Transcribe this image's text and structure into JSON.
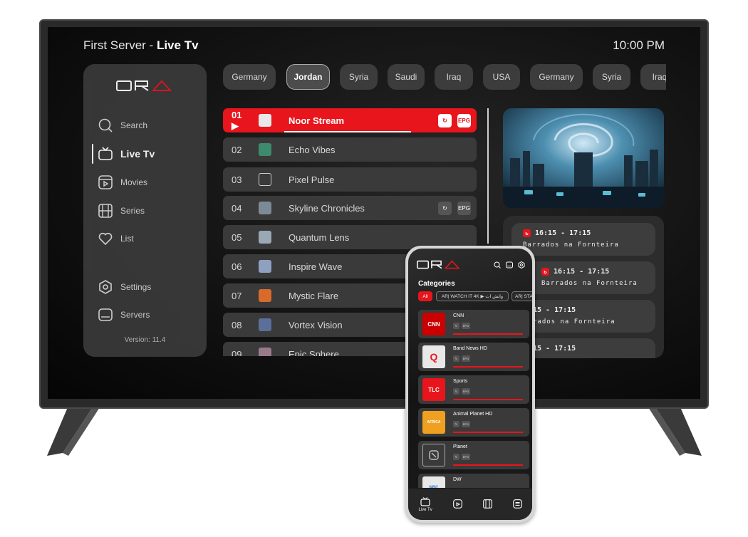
{
  "tv": {
    "server_name": "First Server - ",
    "section": "Live Tv",
    "clock": "10:00 PM",
    "brand": "ORA",
    "sidebar": {
      "items": [
        {
          "label": "Search",
          "icon": "search-icon"
        },
        {
          "label": "Live Tv",
          "icon": "tv-icon",
          "active": true
        },
        {
          "label": "Movies",
          "icon": "movie-icon"
        },
        {
          "label": "Series",
          "icon": "film-icon"
        },
        {
          "label": "List",
          "icon": "heart-icon"
        },
        {
          "label": "Settings",
          "icon": "settings-icon"
        },
        {
          "label": "Servers",
          "icon": "server-icon"
        }
      ],
      "version": "Version: 11.4"
    },
    "tabs": [
      "Germany",
      "Jordan",
      "Syria",
      "Saudi",
      "Iraq",
      "USA",
      "Germany",
      "Syria",
      "Iraq"
    ],
    "active_tab": "Jordan",
    "channels": [
      {
        "num": "01",
        "name": "Noor Stream",
        "active": true,
        "badges": true
      },
      {
        "num": "02",
        "name": "Echo Vibes"
      },
      {
        "num": "03",
        "name": "Pixel Pulse"
      },
      {
        "num": "04",
        "name": "Skyline Chronicles",
        "badges": true
      },
      {
        "num": "05",
        "name": "Quantum Lens"
      },
      {
        "num": "06",
        "name": "Inspire Wave"
      },
      {
        "num": "07",
        "name": "Mystic Flare"
      },
      {
        "num": "08",
        "name": "Vortex Vision"
      },
      {
        "num": "09",
        "name": "Epic Sphere"
      }
    ],
    "badge_epg": "EPG",
    "epg": [
      {
        "time": "16:15 - 17:15",
        "program": "Barrados na Fornteira"
      },
      {
        "time": "16:15 - 17:15",
        "program": "Barrados na Fornteira"
      },
      {
        "time": "15 - 17:15",
        "program": "rados na Fornteira"
      },
      {
        "time": "15 - 17:15",
        "program": ""
      }
    ]
  },
  "phone": {
    "brand": "ORA",
    "categories_title": "Categories",
    "chips": [
      "All",
      "AR| WATCH IT 4K ▶ واتش ات",
      "AR| STA"
    ],
    "channels": [
      {
        "name": "CNN",
        "thumb": "CNN",
        "thumb_color": "#cc0000"
      },
      {
        "name": "Band News HD",
        "thumb": "Q",
        "thumb_color": "#e8151d"
      },
      {
        "name": "Sports",
        "thumb": "TLC",
        "thumb_color": "#e8151d"
      },
      {
        "name": "Animal Planet HD",
        "thumb": "AFRICA",
        "thumb_color": "#f0a020"
      },
      {
        "name": "Planet",
        "thumb": "",
        "thumb_color": "#3a3a3a"
      },
      {
        "name": "DW",
        "thumb": "NBC",
        "thumb_color": "#ffffff"
      }
    ],
    "badge_epg": "EPG",
    "nav": [
      {
        "label": "Live Tv",
        "icon": "tv-icon"
      },
      {
        "label": "",
        "icon": "movie-icon"
      },
      {
        "label": "",
        "icon": "film-icon"
      },
      {
        "label": "",
        "icon": "list-icon"
      }
    ]
  },
  "colors": {
    "accent": "#e8151d",
    "panel": "#3a3a3a",
    "background": "#121212"
  }
}
